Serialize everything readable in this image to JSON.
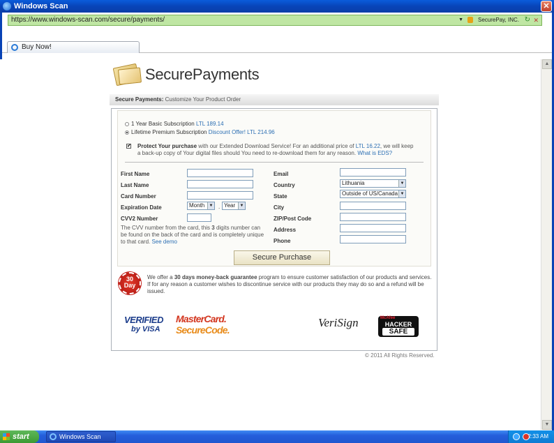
{
  "window": {
    "title": "Windows Scan",
    "close_glyph": "✕"
  },
  "address_bar": {
    "url": "https://www.windows-scan.com/secure/payments/",
    "security_label": "SecurePay, INC.",
    "refresh_glyph": "↻",
    "stop_glyph": "✕",
    "dropdown_glyph": "▼"
  },
  "tab": {
    "label": "Buy Now!"
  },
  "page": {
    "logo_text": "SecurePayments",
    "section_title_bold": "Secure Payments:",
    "section_title_rest": "Customize Your Product Order",
    "options": [
      {
        "label": "1 Year Basic Subscription",
        "price": "LTL 189.14",
        "selected": false
      },
      {
        "label": "Lifetime Premium Subscription",
        "price": "Discount Offer! LTL 214.96",
        "selected": true
      }
    ],
    "protect": {
      "checked_glyph": "✔",
      "bold": "Protect Your purchase",
      "text1": " with our Extended Download Service! For an additional price of ",
      "price": "LTL 16.22",
      "text2": ", we will keep a back-up copy of Your digital files should You need to re-download them for any reason. ",
      "link": "What is EDS?"
    },
    "form": {
      "first_name": "First Name",
      "last_name": "Last Name",
      "card_number": "Card Number",
      "expiration_date": "Expiration Date",
      "month": "Month",
      "year": "Year",
      "date_sep": ".",
      "cvv2": "CVV2 Number",
      "cvv_note": "The CVV number from the card, this ",
      "cvv_note_bold": "3",
      "cvv_note2": " digits number can be found on the back of the card and is completely unique to that card. ",
      "see_demo": "See demo",
      "email": "Email",
      "country": "Country",
      "country_value": "Lithuania",
      "state": "State",
      "state_value": "Outside of US/Canada",
      "city": "City",
      "zip": "ZIP/Post Code",
      "address": "Address",
      "phone": "Phone",
      "select_arrow": "▼",
      "submit": "Secure Purchase"
    },
    "guarantee": {
      "seal_line1": "30",
      "seal_line2": "Day",
      "text1": "We offer a ",
      "bold": "30 days money-back guarantee",
      "text2": " program to ensure customer satisfaction of our products and services. If for any reason a customer wishes to discontinue service with our products they may do so and a refund will be issued."
    },
    "badges": {
      "visa1": "VERIFIED",
      "visa2": "by VISA",
      "mc1": "MasterCard.",
      "mc2": "SecureCode.",
      "verisign": "VeriSign",
      "hacker0": "McAfee",
      "hacker1": "HACKER",
      "hacker2": "SAFE"
    },
    "copyright": "© 2011 All Rights Reserved."
  },
  "scrollbar": {
    "up": "▲",
    "down": "▼"
  },
  "taskbar": {
    "start": "start",
    "task": "Windows Scan",
    "clock": "2:33 AM"
  }
}
